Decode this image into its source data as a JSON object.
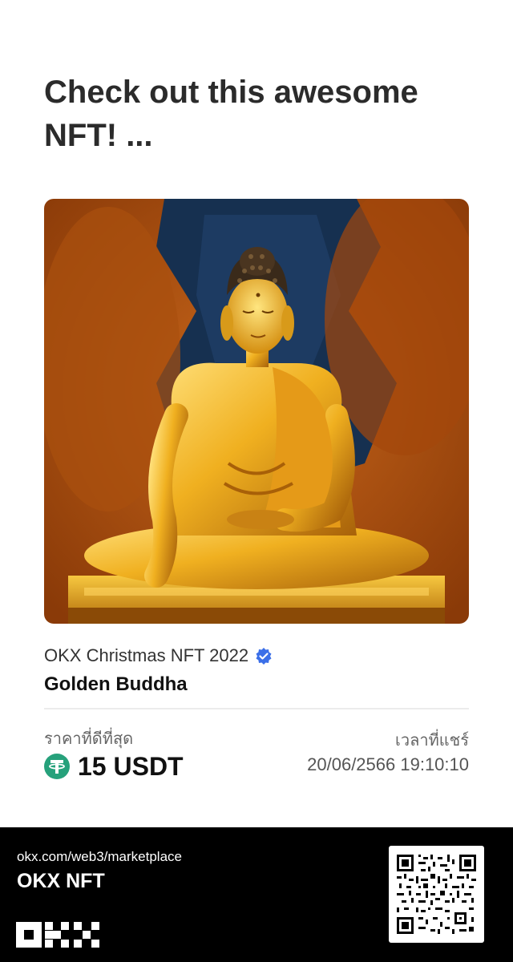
{
  "headline": "Check out this awesome NFT!  ...",
  "nft": {
    "image_icon": "golden-buddha-artwork",
    "collection": "OKX Christmas NFT 2022",
    "verified_icon": "verified-badge-icon",
    "name": "Golden Buddha"
  },
  "price": {
    "label": "ราคาที่ดีที่สุด",
    "token_icon": "usdt-icon",
    "value": "15 USDT"
  },
  "share": {
    "label": "เวลาที่แชร์",
    "time": "20/06/2566 19:10:10"
  },
  "footer": {
    "url": "okx.com/web3/marketplace",
    "brand": "OKX NFT",
    "logo_icon": "okx-logo-icon",
    "qr_icon": "qr-code-icon"
  },
  "colors": {
    "verified": "#3b6fe8",
    "usdt": "#26a17b",
    "footer_bg": "#000000"
  }
}
